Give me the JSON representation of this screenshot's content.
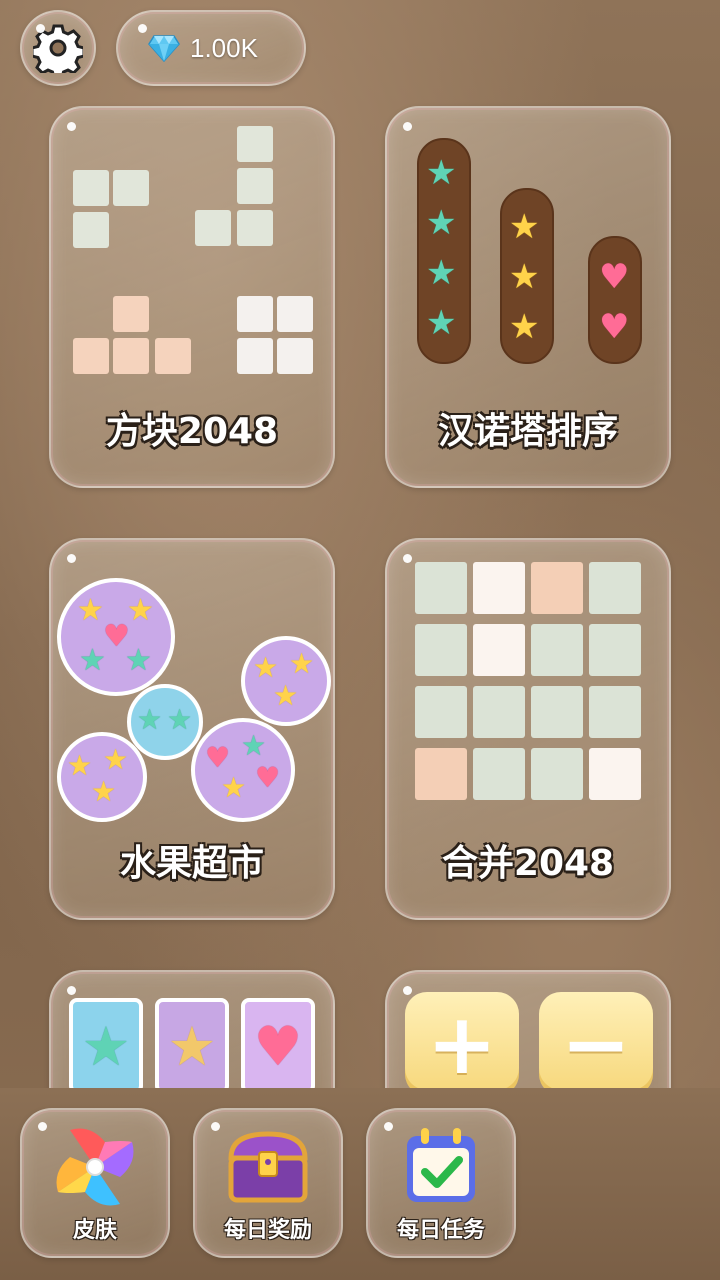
{
  "header": {
    "settings_icon": "gear-icon",
    "gems": {
      "icon": "diamond-icon",
      "value": "1.00K"
    }
  },
  "games": [
    {
      "title": "方块2048",
      "icon": "block-tetromino-icon"
    },
    {
      "title": "汉诺塔排序",
      "icon": "hanoi-sort-icon"
    },
    {
      "title": "水果超市",
      "icon": "fruit-ball-icon"
    },
    {
      "title": "合并2048",
      "icon": "merge-grid-icon"
    },
    {
      "title": "",
      "icon": "card-match-icon"
    },
    {
      "title": "",
      "icon": "plus-minus-icon"
    }
  ],
  "bottom_nav": [
    {
      "label": "皮肤",
      "icon": "pinwheel-icon"
    },
    {
      "label": "每日奖励",
      "icon": "treasure-chest-icon"
    },
    {
      "label": "每日任务",
      "icon": "calendar-check-icon"
    }
  ],
  "colors": {
    "background": "#8f7358",
    "tile_green": "#e1e6da",
    "tile_peach": "#f5d3bd",
    "tile_white": "#f4f1ee",
    "pillar": "#6f4426",
    "star_teal": "#5fd3b5",
    "star_yellow": "#ffd34a",
    "heart_pink": "#ff6c96"
  }
}
